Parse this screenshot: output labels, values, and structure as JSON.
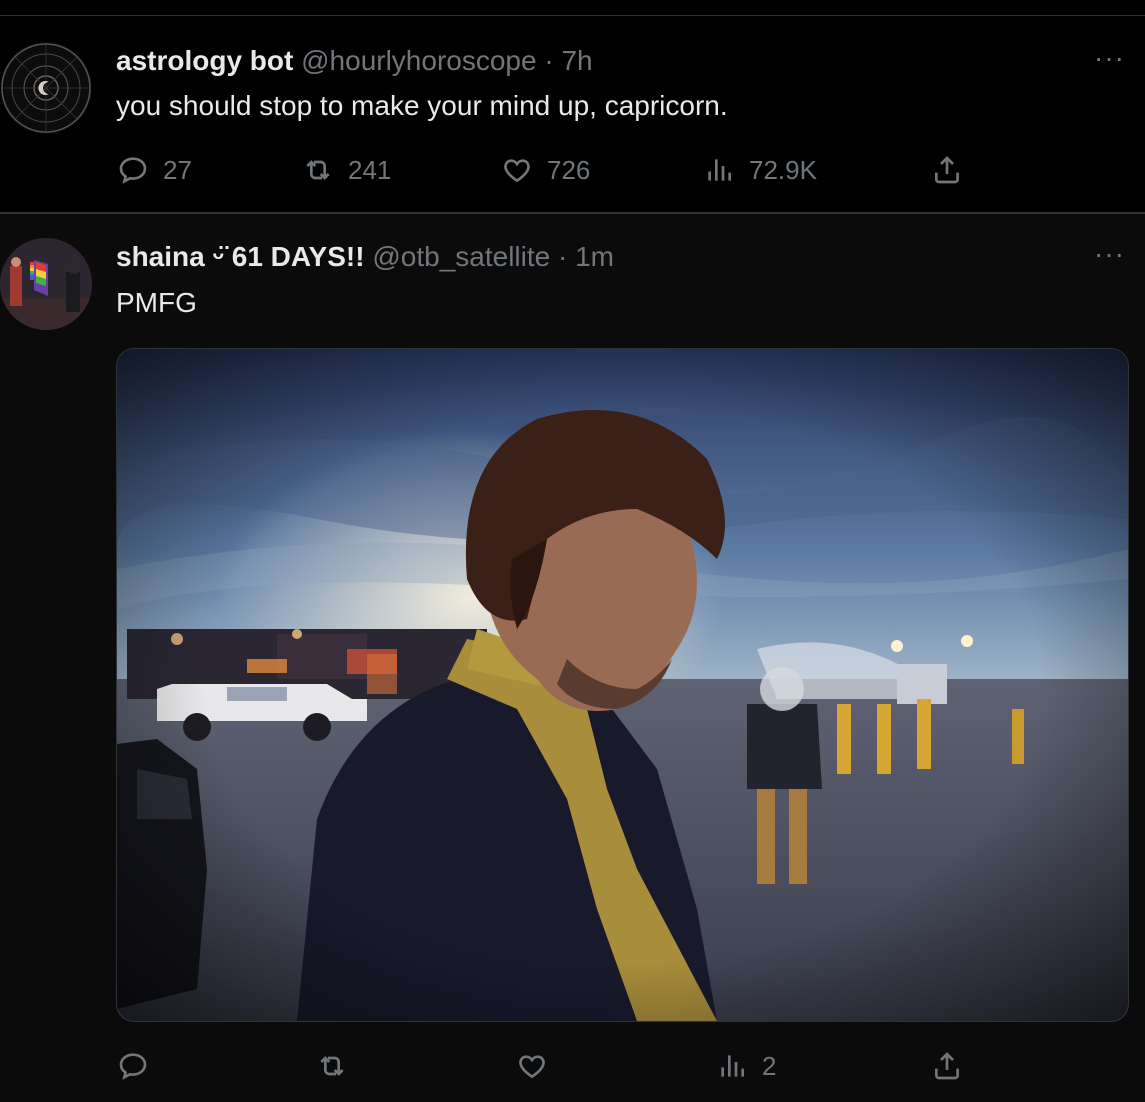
{
  "tweets": [
    {
      "display_name": "astrology bot",
      "handle": "@hourlyhoroscope",
      "separator": "·",
      "time": "7h",
      "text": "you should stop to make your mind up, capricorn.",
      "more_label": "···",
      "actions": {
        "reply_count": "27",
        "retweet_count": "241",
        "like_count": "726",
        "views_count": "72.9K"
      }
    },
    {
      "display_name": "shaina ᵕ̈ 61 DAYS!!",
      "handle": "@otb_satellite",
      "separator": "·",
      "time": "1m",
      "text": "PMFG",
      "more_label": "···",
      "actions": {
        "views_count": "2"
      }
    }
  ],
  "icons": {
    "reply": "reply-icon",
    "retweet": "retweet-icon",
    "like": "heart-icon",
    "views": "views-icon",
    "share": "share-icon",
    "more": "more-icon"
  },
  "colors": {
    "background": "#000000",
    "text_primary": "#e7e9ea",
    "text_secondary": "#71767b",
    "divider": "#2f3336"
  }
}
